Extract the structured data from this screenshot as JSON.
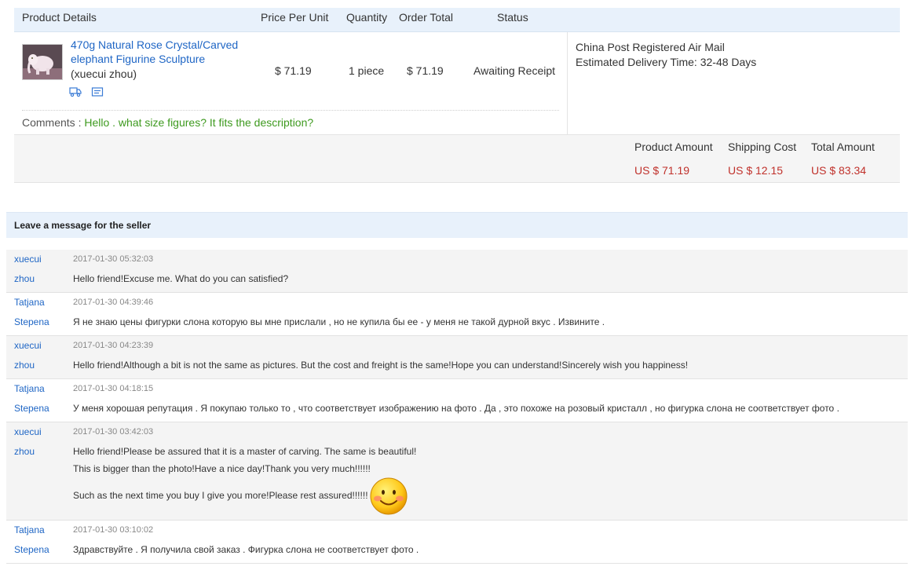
{
  "order": {
    "headers": {
      "product_details": "Product Details",
      "price_per_unit": "Price Per Unit",
      "quantity": "Quantity",
      "order_total": "Order Total",
      "status": "Status"
    },
    "item": {
      "title_line1": "470g Natural Rose Crystal/Carved",
      "title_line2": "elephant Figurine Sculpture",
      "seller": "(xuecui zhou)",
      "price": "$ 71.19",
      "quantity": "1 piece",
      "total": "$ 71.19",
      "status": "Awaiting Receipt",
      "icons": [
        "shipping-truck-icon",
        "snapshot-icon"
      ]
    },
    "comment_label": "Comments :",
    "comment_text": "Hello . what size figures? It fits the description?",
    "shipping": {
      "method": "China Post Registered Air Mail",
      "estimated": "Estimated Delivery Time: 32-48 Days"
    },
    "totals": {
      "product_amount_label": "Product Amount",
      "product_amount": "US $ 71.19",
      "shipping_cost_label": "Shipping Cost",
      "shipping_cost": "US $ 12.15",
      "total_amount_label": "Total Amount",
      "total_amount": "US $ 83.34"
    },
    "colors": {
      "link": "#1f66c5",
      "price": "#c0312b",
      "comment": "#3e9a1f",
      "header_bg": "#e8f1fb"
    }
  },
  "messages_section": {
    "title": "Leave a message for the seller",
    "messages": [
      {
        "first": "xuecui",
        "last": "zhou",
        "time": "2017-01-30 05:32:03",
        "lines": [
          "Hello friend!Excuse me. What do you can satisfied?"
        ]
      },
      {
        "first": "Tatjana",
        "last": "Stepena",
        "time": "2017-01-30 04:39:46",
        "lines": [
          "Я не знаю цены фигурки слона которую вы мне прислали , но не купила бы ее - у меня не такой дурной вкус . Извините ."
        ]
      },
      {
        "first": "xuecui",
        "last": "zhou",
        "time": "2017-01-30 04:23:39",
        "lines": [
          "Hello friend!Although a bit is not the same as pictures. But the cost and freight is the same!Hope you can understand!Sincerely wish you happiness!"
        ]
      },
      {
        "first": "Tatjana",
        "last": "Stepena",
        "time": "2017-01-30 04:18:15",
        "lines": [
          "У меня хорошая репутация . Я покупаю только то , что соответствует изображению на фото . Да , это похоже на розовый кристалл , но фигурка слона не соответствует фото ."
        ]
      },
      {
        "first": "xuecui",
        "last": "zhou",
        "time": "2017-01-30 03:42:03",
        "lines": [
          "Hello friend!Please be assured that it is a master of carving. The same is beautiful!",
          "This is bigger than the photo!Have a nice day!Thank you very much!!!!!!",
          "Such as the next time you buy I give you more!Please rest assured!!!!!!"
        ],
        "emoji": "smiley-face-icon"
      },
      {
        "first": "Tatjana",
        "last": "Stepena",
        "time": "2017-01-30 03:10:02",
        "lines": [
          "Здравствуйте . Я получила свой заказ . Фигурка слона не соответствует фото ."
        ]
      }
    ]
  }
}
